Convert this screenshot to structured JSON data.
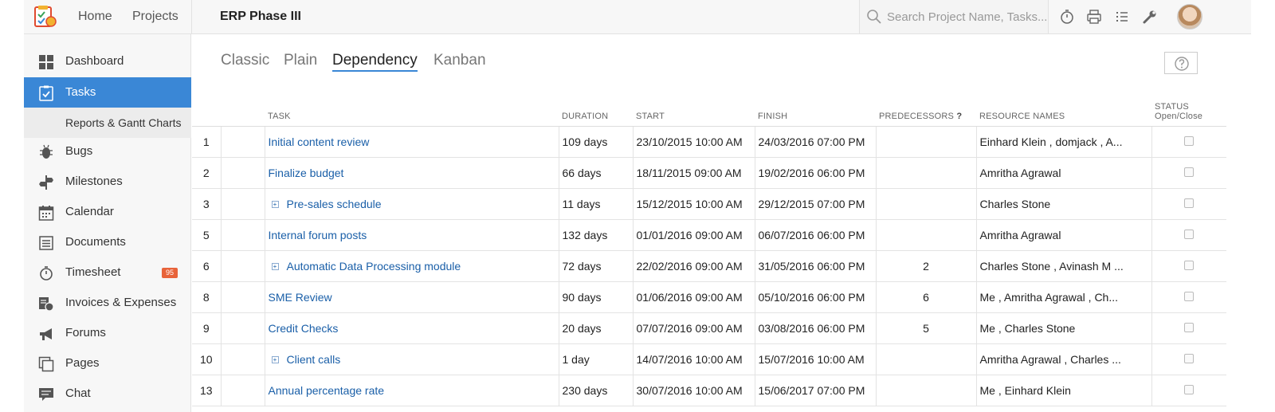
{
  "topbar": {
    "home": "Home",
    "projects": "Projects",
    "project_title": "ERP Phase III",
    "search_placeholder": "Search Project Name, Tasks..."
  },
  "sidebar": {
    "items": [
      {
        "label": "Dashboard",
        "icon": "dashboard-icon"
      },
      {
        "label": "Tasks",
        "icon": "tasks-icon"
      },
      {
        "label": "Reports & Gantt Charts",
        "icon": ""
      },
      {
        "label": "Bugs",
        "icon": "bug-icon"
      },
      {
        "label": "Milestones",
        "icon": "milestone-icon"
      },
      {
        "label": "Calendar",
        "icon": "calendar-icon"
      },
      {
        "label": "Documents",
        "icon": "documents-icon"
      },
      {
        "label": "Timesheet",
        "icon": "timer-icon",
        "badge": "95"
      },
      {
        "label": "Invoices & Expenses",
        "icon": "invoice-icon"
      },
      {
        "label": "Forums",
        "icon": "megaphone-icon"
      },
      {
        "label": "Pages",
        "icon": "pages-icon"
      },
      {
        "label": "Chat",
        "icon": "chat-icon"
      }
    ]
  },
  "tabs": [
    "Classic",
    "Plain",
    "Dependency",
    "Kanban"
  ],
  "active_tab": "Dependency",
  "table": {
    "headers": {
      "task": "TASK",
      "duration": "DURATION",
      "start": "START",
      "finish": "FINISH",
      "predecessors": "PREDECESSORS",
      "predecessors_q": "?",
      "resources": "RESOURCE NAMES",
      "status": "STATUS",
      "status_sub": "Open/Close"
    },
    "rows": [
      {
        "id": "1",
        "task": "Initial content review",
        "expandable": false,
        "duration": "109 days",
        "start": "23/10/2015 10:00 AM",
        "finish": "24/03/2016 07:00 PM",
        "pred": "",
        "resources": "Einhard Klein , domjack , A..."
      },
      {
        "id": "2",
        "task": "Finalize budget",
        "expandable": false,
        "duration": "66 days",
        "start": "18/11/2015 09:00 AM",
        "finish": "19/02/2016 06:00 PM",
        "pred": "",
        "resources": "Amritha Agrawal"
      },
      {
        "id": "3",
        "task": "Pre-sales schedule",
        "expandable": true,
        "duration": "11 days",
        "start": "15/12/2015 10:00 AM",
        "finish": "29/12/2015 07:00 PM",
        "pred": "",
        "resources": "Charles Stone"
      },
      {
        "id": "5",
        "task": "Internal forum posts",
        "expandable": false,
        "duration": "132 days",
        "start": "01/01/2016 09:00 AM",
        "finish": "06/07/2016 06:00 PM",
        "pred": "",
        "resources": "Amritha Agrawal"
      },
      {
        "id": "6",
        "task": "Automatic Data Processing module",
        "expandable": true,
        "duration": "72 days",
        "start": "22/02/2016 09:00 AM",
        "finish": "31/05/2016 06:00 PM",
        "pred": "2",
        "resources": "Charles Stone , Avinash M ..."
      },
      {
        "id": "8",
        "task": "SME Review",
        "expandable": false,
        "duration": "90 days",
        "start": "01/06/2016 09:00 AM",
        "finish": "05/10/2016 06:00 PM",
        "pred": "6",
        "resources": "Me , Amritha Agrawal , Ch..."
      },
      {
        "id": "9",
        "task": "Credit Checks",
        "expandable": false,
        "duration": "20 days",
        "start": "07/07/2016 09:00 AM",
        "finish": "03/08/2016 06:00 PM",
        "pred": "5",
        "resources": "Me , Charles Stone"
      },
      {
        "id": "10",
        "task": "Client calls",
        "expandable": true,
        "duration": "1 day",
        "start": "14/07/2016 10:00 AM",
        "finish": "15/07/2016 10:00 AM",
        "pred": "",
        "resources": "Amritha Agrawal , Charles ..."
      },
      {
        "id": "13",
        "task": "Annual percentage rate",
        "expandable": false,
        "duration": "230 days",
        "start": "30/07/2016 10:00 AM",
        "finish": "15/06/2017 07:00 PM",
        "pred": "",
        "resources": "Me , Einhard Klein"
      }
    ]
  },
  "colors": {
    "accent": "#3a87d6",
    "link": "#1a5fa8",
    "badge": "#e8633a"
  }
}
